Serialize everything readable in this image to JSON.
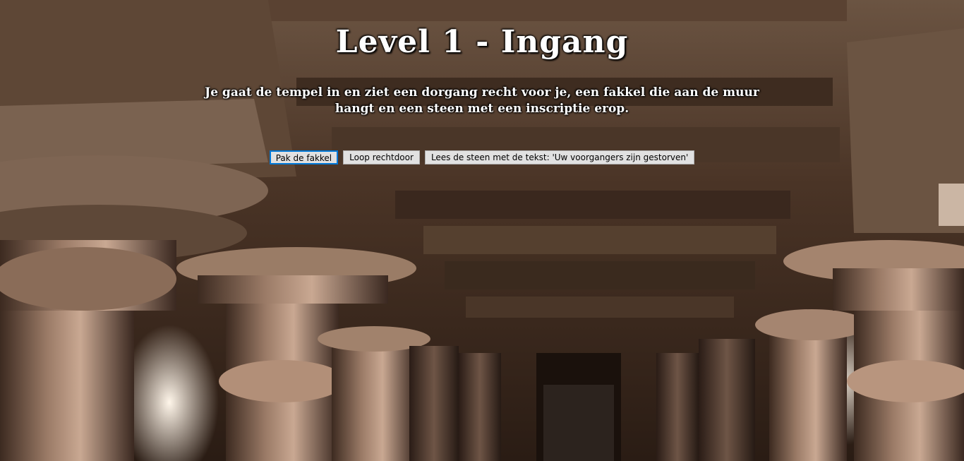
{
  "level": {
    "title": "Level 1 - Ingang",
    "description": "Je gaat de tempel in en ziet een dorgang recht voor je, een fakkel die aan de muur hangt en een steen met een inscriptie erop."
  },
  "actions": [
    {
      "label": "Pak de fakkel"
    },
    {
      "label": "Loop rechtdoor"
    },
    {
      "label": "Lees de steen met de tekst: 'Uw voorgangers zijn gestorven'"
    }
  ],
  "colors": {
    "text": "#ffffff",
    "button_bg": "#e1e1e1",
    "button_focus": "#0078d7"
  }
}
